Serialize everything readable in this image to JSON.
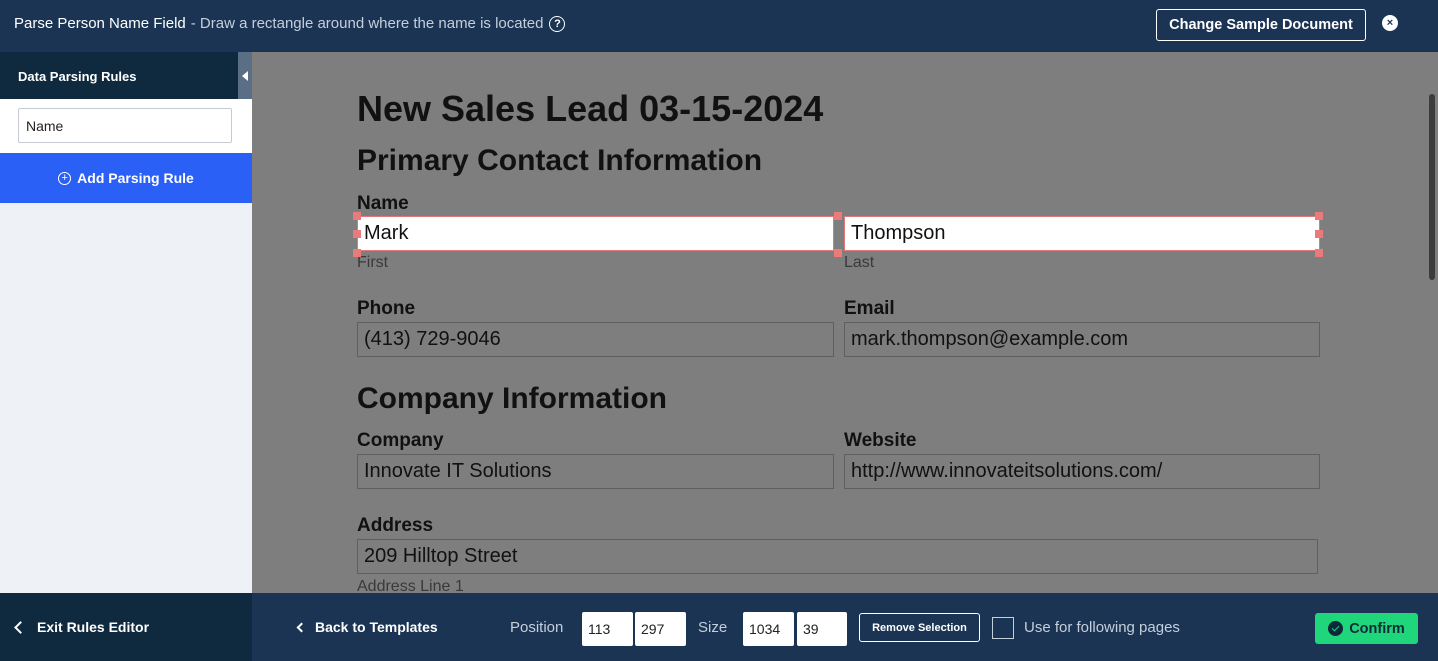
{
  "header": {
    "title": "Parse Person Name Field",
    "subtitle": "- Draw a rectangle around where the name is located",
    "help_icon": "?",
    "change_doc_label": "Change Sample Document",
    "close_icon": "×"
  },
  "sidebar": {
    "title": "Data Parsing Rules",
    "rule_name_value": "Name",
    "add_rule_label": "Add Parsing Rule",
    "add_icon": "+"
  },
  "document": {
    "title": "New Sales Lead 03-15-2024",
    "primary_section": "Primary Contact Information",
    "name_label": "Name",
    "first_value": "Mark",
    "last_value": "Thompson",
    "first_caption": "First",
    "last_caption": "Last",
    "phone_label": "Phone",
    "phone_value": "(413) 729-9046",
    "email_label": "Email",
    "email_value": "mark.thompson@example.com",
    "company_section": "Company Information",
    "company_label": "Company",
    "company_value": "Innovate IT Solutions",
    "website_label": "Website",
    "website_value": "http://www.innovateitsolutions.com/",
    "address_label": "Address",
    "address_value": "209 Hilltop Street",
    "address_caption": "Address Line 1"
  },
  "footer": {
    "exit_label": "Exit Rules Editor",
    "back_label": "Back to Templates",
    "position_label": "Position",
    "position_x": "113",
    "position_y": "297",
    "size_label": "Size",
    "size_w": "1034",
    "size_h": "39",
    "remove_label": "Remove Selection",
    "following_label": "Use for following pages",
    "following_checked": false,
    "confirm_label": "Confirm"
  },
  "colors": {
    "header_bg": "#1b3454",
    "sidebar_header_bg": "#0f2a3e",
    "accent_blue": "#2b60f6",
    "confirm_green": "#1fd67a",
    "selection_handle": "#e97b7b",
    "document_overlay": "#7e7e7e"
  }
}
